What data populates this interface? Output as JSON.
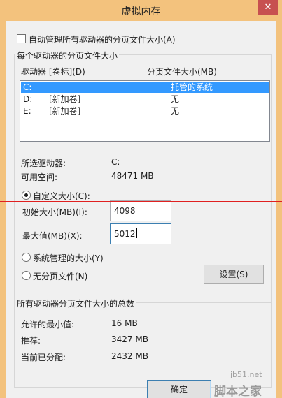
{
  "window": {
    "title": "虚拟内存",
    "close_glyph": "✕"
  },
  "auto_manage": {
    "label": "自动管理所有驱动器的分页文件大小(A)",
    "checked": false
  },
  "per_drive": {
    "group_label": "每个驱动器的分页文件大小",
    "col_drive": "驱动器 [卷标](D)",
    "col_size": "分页文件大小(MB)",
    "rows": [
      {
        "drive": "C:",
        "label": "",
        "size": "托管的系统",
        "selected": true
      },
      {
        "drive": "D:",
        "label": "[新加卷]",
        "size": "无",
        "selected": false
      },
      {
        "drive": "E:",
        "label": "[新加卷]",
        "size": "无",
        "selected": false
      }
    ],
    "selected_drive_label": "所选驱动器:",
    "selected_drive_value": "C:",
    "free_space_label": "可用空间:",
    "free_space_value": "48471 MB"
  },
  "options": {
    "custom_label": "自定义大小(C):",
    "initial_label": "初始大小(MB)(I):",
    "initial_value": "4098",
    "max_label": "最大值(MB)(X):",
    "max_value": "5012",
    "system_label": "系统管理的大小(Y)",
    "none_label": "无分页文件(N)",
    "selected": "custom"
  },
  "set_button": "设置(S)",
  "totals": {
    "group_label": "所有驱动器分页文件大小的总数",
    "min_label": "允许的最小值:",
    "min_value": "16 MB",
    "recommended_label": "推荐:",
    "recommended_value": "3427 MB",
    "allocated_label": "当前已分配:",
    "allocated_value": "2432 MB"
  },
  "ok_button": "确定",
  "watermark": {
    "site": "jb51.net",
    "brand": "脚本之家"
  },
  "colors": {
    "title_bar": "#f3c27d",
    "selection": "#3399ff",
    "red_line": "#e02020"
  }
}
